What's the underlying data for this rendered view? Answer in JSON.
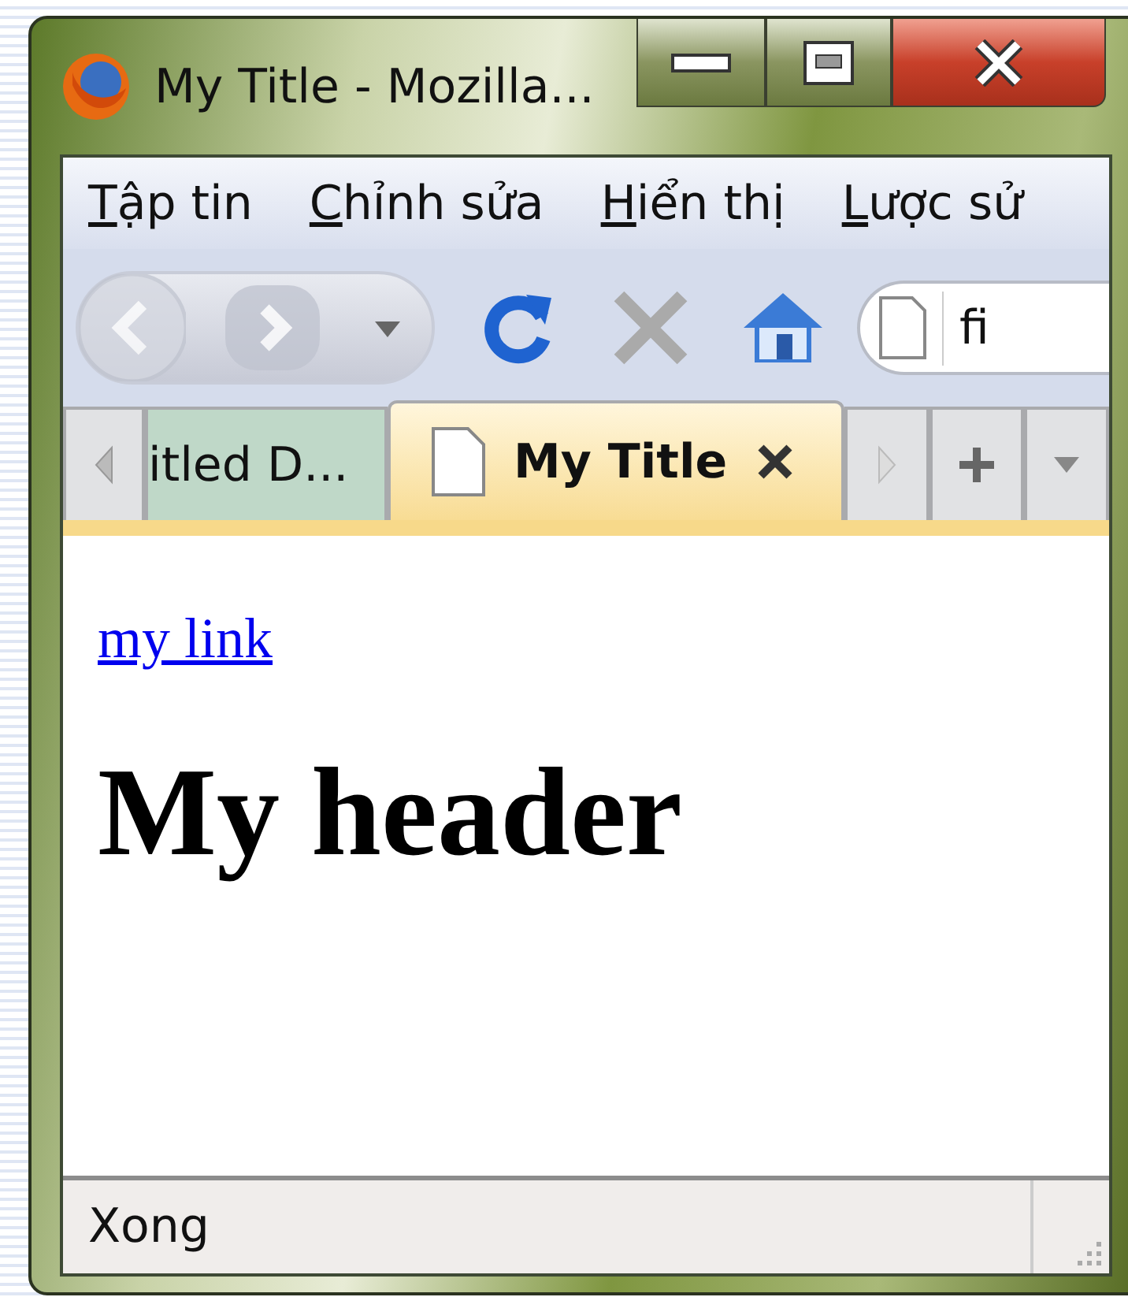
{
  "window": {
    "title": "My Title - Mozilla..."
  },
  "menu": [
    "Tập tin",
    "Chỉnh sửa",
    "Hiển thị",
    "Lược sử"
  ],
  "navigation": {
    "back": {
      "disabled": true
    },
    "forward": {
      "disabled": true
    },
    "stop": {
      "disabled": true
    }
  },
  "address_bar": {
    "value": "fi"
  },
  "tabs": [
    {
      "label": "itled D...",
      "selected": false
    },
    {
      "label": "My Title",
      "selected": true
    }
  ],
  "content": {
    "link": "my link",
    "heading": "My header"
  },
  "status_bar": {
    "text": "Xong"
  }
}
